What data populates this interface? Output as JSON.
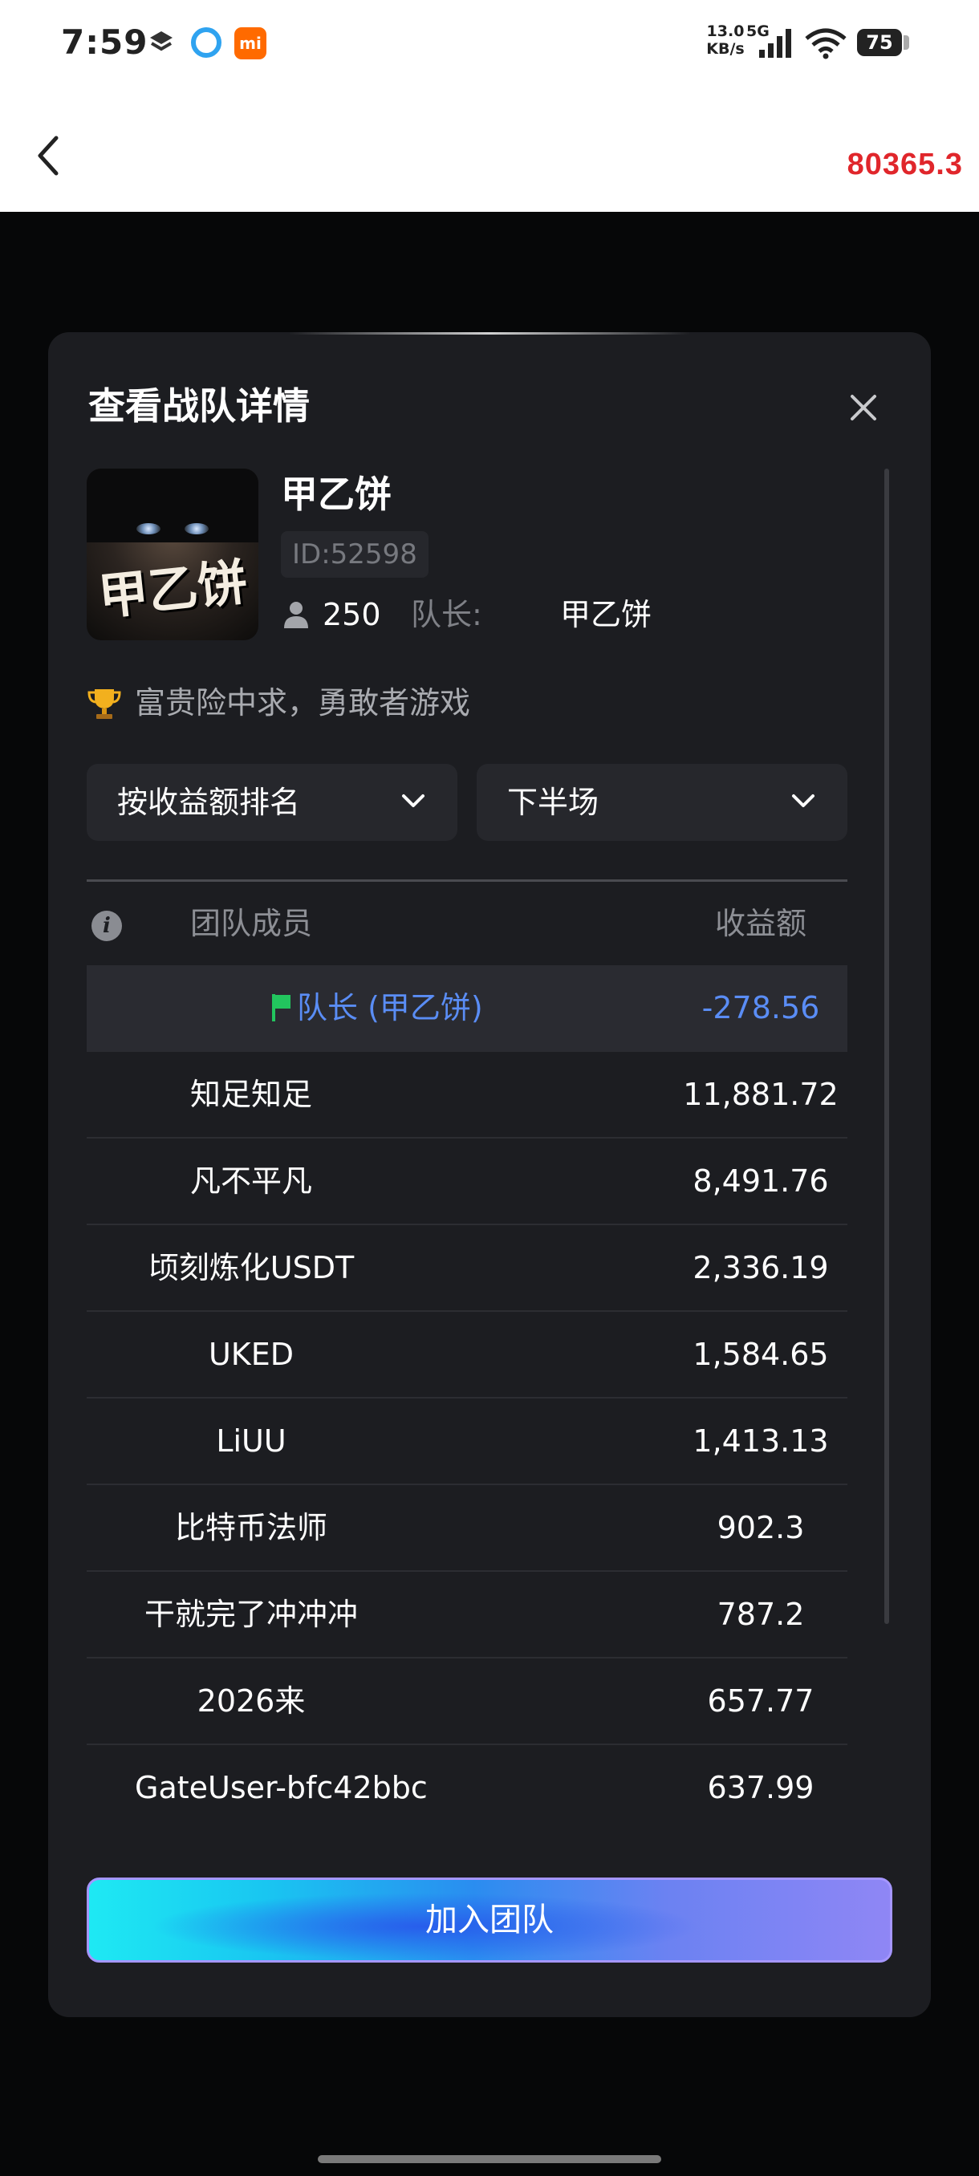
{
  "status_bar": {
    "time": "7:59",
    "net_speed_value": "13.0",
    "net_speed_unit": "KB/s",
    "network_type": "5G",
    "battery": "75",
    "mi_icon_text": "mi"
  },
  "header": {
    "balance": "80365.3"
  },
  "modal": {
    "title": "查看战队详情",
    "team": {
      "name": "甲乙饼",
      "avatar_text": "甲乙饼",
      "id": "ID:52598",
      "member_count": "250",
      "captain_label": "队长:",
      "captain_name": "甲乙饼",
      "slogan": "富贵险中求，勇敢者游戏"
    },
    "filters": {
      "sort": "按收益额排名",
      "period": "下半场"
    },
    "table": {
      "headers": {
        "member": "团队成员",
        "earnings": "收益额"
      },
      "captain_row": {
        "name": "队长 (甲乙饼)",
        "value": "-278.56"
      },
      "rows": [
        {
          "name": "知足知足",
          "value": "11,881.72"
        },
        {
          "name": "凡不平凡",
          "value": "8,491.76"
        },
        {
          "name": "顷刻炼化USDT",
          "value": "2,336.19"
        },
        {
          "name": "UKED",
          "value": "1,584.65"
        },
        {
          "name": "LiUU",
          "value": "1,413.13"
        },
        {
          "name": "比特币法师",
          "value": "902.3"
        },
        {
          "name": "干就完了冲冲冲",
          "value": "787.2"
        },
        {
          "name": "2026来",
          "value": "657.77"
        },
        {
          "name": "GateUser-bfc42bbc",
          "value": "637.99"
        }
      ]
    },
    "join_button": "加入团队"
  },
  "colors": {
    "balance": "#e0262b",
    "captain_highlight": "#5a8df5",
    "flag": "#22c55e",
    "modal_bg": "#1c1d21"
  }
}
